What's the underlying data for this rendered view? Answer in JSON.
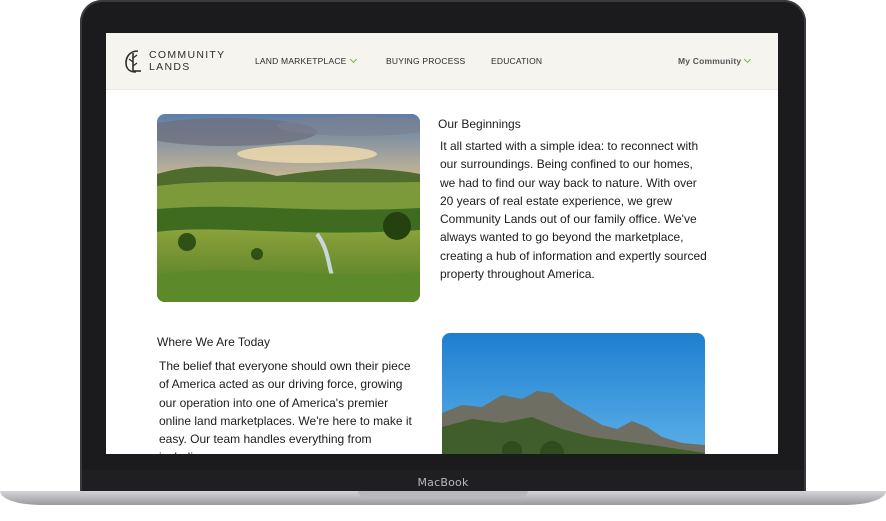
{
  "device": {
    "label": "MacBook"
  },
  "header": {
    "logo": {
      "line1": "COMMUNITY",
      "line2": "LANDS"
    },
    "nav": [
      {
        "label": "LAND MARKETPLACE"
      },
      {
        "label": "BUYING PROCESS"
      },
      {
        "label": "EDUCATION"
      }
    ],
    "account_menu": {
      "label": "My Community"
    }
  },
  "sections": {
    "beginnings": {
      "title": "Our Beginnings",
      "body": "It all started with a simple idea: to reconnect with our surroundings. Being confined to our homes, we had to find our way back to nature. With over 20 years of real estate experience, we grew Community Lands out of our family office. We've always wanted to go beyond the marketplace, creating a hub of information and expertly sourced property throughout America."
    },
    "today": {
      "title": "Where We Are Today",
      "body": "The belief that everyone should own their piece of America acted as our driving force, growing our operation into one of America's premier online land marketplaces. We're here to make it easy. Our team handles everything from including..."
    }
  },
  "colors": {
    "accent": "#7cb342",
    "header_bg": "#f6f4ef",
    "text": "#1c1c1c"
  }
}
